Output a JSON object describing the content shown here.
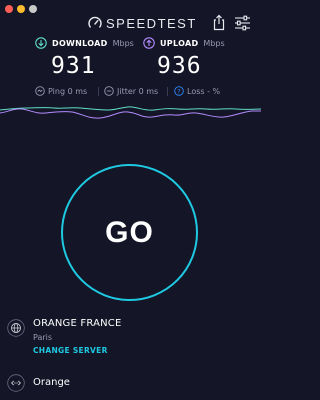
{
  "app": {
    "logo_text": "SPEEDTEST"
  },
  "colors": {
    "background": "#141526",
    "download_accent": "#5fe0c8",
    "upload_accent": "#b38cff",
    "go_ring": "#1fc9e2",
    "link": "#1fc9e2",
    "muted_text": "#9a9bb0"
  },
  "icons": {
    "download": "download-arrow-icon",
    "upload": "upload-arrow-icon",
    "share": "share-icon",
    "settings": "sliders-icon",
    "ping": "ping-icon",
    "jitter": "jitter-icon",
    "loss": "loss-icon",
    "isp": "globe-icon",
    "connection": "connection-icon"
  },
  "download": {
    "label": "DOWNLOAD",
    "unit": "Mbps",
    "value": "931"
  },
  "upload": {
    "label": "UPLOAD",
    "unit": "Mbps",
    "value": "936"
  },
  "stats": {
    "ping": "Ping 0 ms",
    "jitter": "Jitter 0 ms",
    "loss": "Loss - %"
  },
  "go_button": {
    "label": "GO"
  },
  "server": {
    "isp": "ORANGE FRANCE",
    "city": "Paris",
    "change_label": "CHANGE SERVER"
  },
  "connection": {
    "name": "Orange"
  }
}
